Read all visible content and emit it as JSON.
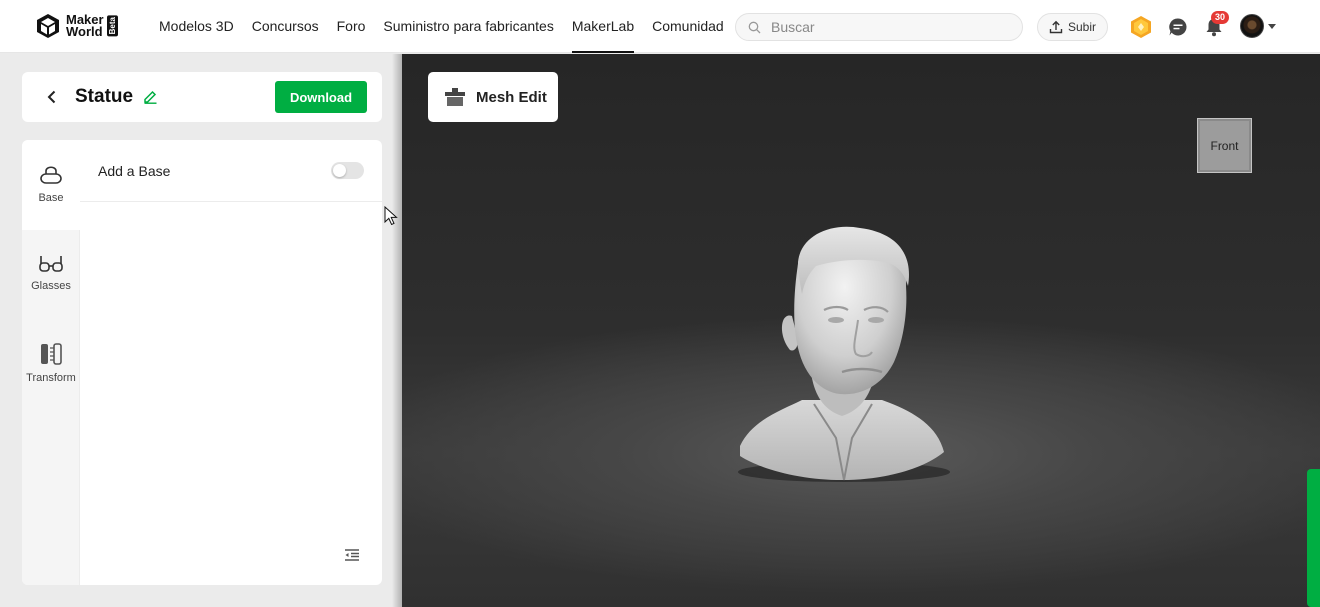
{
  "header": {
    "logo": {
      "line1": "Maker",
      "line2": "World",
      "badge": "Beta"
    },
    "nav": [
      {
        "label": "Modelos 3D",
        "active": false
      },
      {
        "label": "Concursos",
        "active": false
      },
      {
        "label": "Foro",
        "active": false
      },
      {
        "label": "Suministro para fabricantes",
        "active": false
      },
      {
        "label": "MakerLab",
        "active": true
      },
      {
        "label": "Comunidad",
        "active": false
      }
    ],
    "search": {
      "placeholder": "Buscar",
      "value": ""
    },
    "upload_label": "Subir",
    "notification_count": "30"
  },
  "editor": {
    "title": "Statue",
    "download_label": "Download",
    "tools": [
      {
        "label": "Base",
        "icon": "base-icon",
        "active": true
      },
      {
        "label": "Glasses",
        "icon": "glasses-icon",
        "active": false
      },
      {
        "label": "Transform",
        "icon": "transform-icon",
        "active": false
      }
    ],
    "option": {
      "label": "Add a Base",
      "enabled": false
    }
  },
  "viewport": {
    "mesh_edit_label": "Mesh Edit",
    "view_cube_face": "Front"
  },
  "colors": {
    "accent_green": "#00ae42",
    "badge_red": "#e53935",
    "viewport_bg": "#2a2a2a"
  }
}
